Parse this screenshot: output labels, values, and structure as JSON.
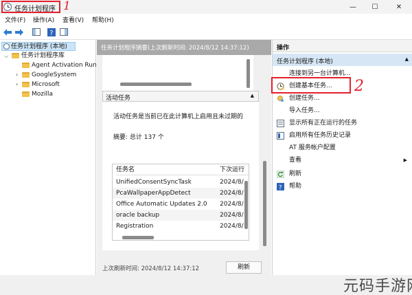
{
  "window": {
    "title": "任务计划程序",
    "minimize": "—",
    "maximize": "☐",
    "close": "✕",
    "annotation_1": "1",
    "annotation_2": "2"
  },
  "menu": {
    "items": [
      "文件(F)",
      "操作(A)",
      "查看(V)",
      "帮助(H)"
    ]
  },
  "toolbar": {
    "icons": [
      "back-arrow-icon",
      "forward-arrow-icon",
      "console-tree-icon",
      "help-icon",
      "properties-icon"
    ]
  },
  "tree": {
    "root": "任务计划程序 (本地)",
    "library": "任务计划程序库",
    "children": [
      "Agent Activation Run",
      "GoogleSystem",
      "Microsoft",
      "Mozilla"
    ]
  },
  "main": {
    "header": "任务计划程序摘要(上次刷新时间: 2024/8/12 14:37:12)",
    "section_title": "活动任务",
    "section_toggle": "▲",
    "description": "活动任务是当前已在此计算机上启用且未过期的",
    "summary": "摘要: 总计 137 个",
    "table": {
      "columns": [
        "任务名",
        "下次运行"
      ],
      "rows": [
        [
          "UnifiedConsentSyncTask",
          "2024/8/"
        ],
        [
          "PcaWallpaperAppDetect",
          "2024/8/"
        ],
        [
          "Office Automatic Updates 2.0",
          "2024/8/"
        ],
        [
          "oracle backup",
          "2024/8/"
        ],
        [
          "Registration",
          "2024/8/"
        ]
      ]
    },
    "footer_text": "上次刷新时间: 2024/8/12 14:37:12",
    "refresh_button": "刷新"
  },
  "actions": {
    "title": "操作",
    "group": "任务计划程序 (本地)",
    "group_toggle": "▲",
    "items": [
      {
        "label": "连接到另一台计算机...",
        "icon": "none"
      },
      {
        "label": "创建基本任务...",
        "icon": "basic-task-icon"
      },
      {
        "label": "创建任务...",
        "icon": "create-task-icon"
      },
      {
        "label": "导入任务...",
        "icon": "none"
      },
      {
        "label": "显示所有正在运行的任务",
        "icon": "running-tasks-icon"
      },
      {
        "label": "启用所有任务历史记录",
        "icon": "history-icon"
      },
      {
        "label": "AT 服务帐户配置",
        "icon": "none"
      },
      {
        "label": "查看",
        "icon": "none"
      },
      {
        "label": "刷新",
        "icon": "refresh-icon"
      },
      {
        "label": "帮助",
        "icon": "help-icon"
      }
    ],
    "submenu_arrow": "▶"
  },
  "watermark": "元码手游网",
  "colors": {
    "annotation": "#e3202d",
    "selection": "#cce4f7",
    "group_header": "#d6e6f5",
    "mid_header": "#a9a9a9"
  }
}
